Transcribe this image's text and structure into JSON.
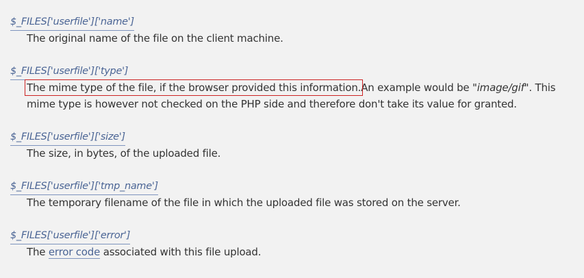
{
  "entries": [
    {
      "term": "$_FILES['userfile']['name']",
      "desc": "The original name of the file on the client machine."
    },
    {
      "term": "$_FILES['userfile']['type']",
      "desc_highlighted": "The mime type of the file, if the browser provided this information.",
      "desc_rest_1": "An example would be \"",
      "desc_emphasis": "image/gif",
      "desc_rest_2": "\". This",
      "desc_line2": "mime type is however not checked on the PHP side and therefore don't take its value for granted."
    },
    {
      "term": "$_FILES['userfile']['size']",
      "desc": "The size, in bytes, of the uploaded file."
    },
    {
      "term": "$_FILES['userfile']['tmp_name']",
      "desc": "The temporary filename of the file in which the uploaded file was stored on the server."
    },
    {
      "term": "$_FILES['userfile']['error']",
      "desc_before": "The ",
      "desc_link": "error code",
      "desc_after": " associated with this file upload."
    }
  ],
  "colors": {
    "background": "#f2f2f2",
    "text": "#333333",
    "link": "#4b6595",
    "highlight_box": "#cc2222"
  }
}
